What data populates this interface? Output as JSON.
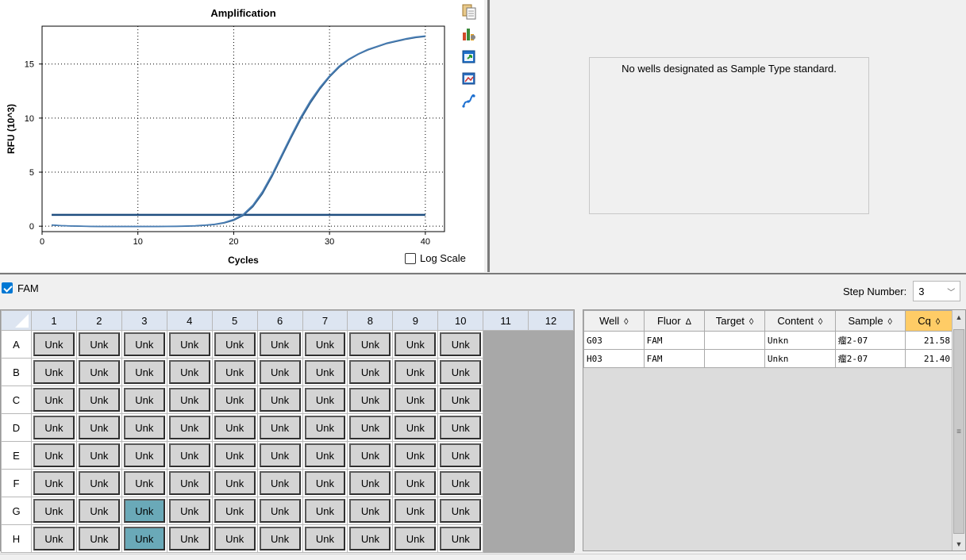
{
  "chart_data": {
    "type": "line",
    "title": "Amplification",
    "xlabel": "Cycles",
    "ylabel": "RFU (10^3)",
    "xlim": [
      0,
      42
    ],
    "ylim": [
      -0.5,
      18.5
    ],
    "xticks": [
      0,
      10,
      20,
      30,
      40
    ],
    "yticks": [
      0,
      5,
      10,
      15
    ],
    "grid": true,
    "threshold": 1.05,
    "series": [
      {
        "well": "G03",
        "color": "#2f5f8f",
        "x": [
          1,
          2,
          3,
          4,
          5,
          6,
          7,
          8,
          9,
          10,
          11,
          12,
          13,
          14,
          15,
          16,
          17,
          18,
          19,
          20,
          21,
          22,
          23,
          24,
          25,
          26,
          27,
          28,
          29,
          30,
          31,
          32,
          33,
          34,
          35,
          36,
          37,
          38,
          39,
          40
        ],
        "y": [
          0.1,
          0.05,
          0.02,
          0,
          -0.02,
          -0.03,
          -0.03,
          -0.03,
          -0.03,
          -0.03,
          -0.03,
          -0.03,
          -0.02,
          -0.02,
          0,
          0.03,
          0.08,
          0.15,
          0.3,
          0.55,
          1.0,
          1.8,
          3.0,
          4.6,
          6.4,
          8.2,
          9.9,
          11.4,
          12.7,
          13.8,
          14.7,
          15.4,
          15.9,
          16.3,
          16.6,
          16.9,
          17.1,
          17.3,
          17.45,
          17.55
        ]
      },
      {
        "well": "H03",
        "color": "#4a7fb5",
        "x": [
          1,
          2,
          3,
          4,
          5,
          6,
          7,
          8,
          9,
          10,
          11,
          12,
          13,
          14,
          15,
          16,
          17,
          18,
          19,
          20,
          21,
          22,
          23,
          24,
          25,
          26,
          27,
          28,
          29,
          30,
          31,
          32,
          33,
          34,
          35,
          36,
          37,
          38,
          39,
          40
        ],
        "y": [
          0.12,
          0.06,
          0.03,
          0.01,
          -0.01,
          -0.02,
          -0.02,
          -0.02,
          -0.02,
          -0.02,
          -0.02,
          -0.02,
          -0.01,
          0,
          0.02,
          0.05,
          0.1,
          0.18,
          0.34,
          0.62,
          1.1,
          1.95,
          3.2,
          4.8,
          6.6,
          8.4,
          10.1,
          11.6,
          12.85,
          13.9,
          14.8,
          15.45,
          15.95,
          16.35,
          16.65,
          16.95,
          17.15,
          17.35,
          17.5,
          17.6
        ]
      }
    ]
  },
  "chart": {
    "log_scale_label": "Log Scale",
    "tools": [
      "copy-icon",
      "chart-settings-icon",
      "export-icon",
      "zoom-icon",
      "trace-icon"
    ]
  },
  "standard_panel": {
    "message": "No wells designated as Sample Type standard."
  },
  "fluor": {
    "label": "FAM",
    "checked": true
  },
  "step": {
    "label": "Step Number:",
    "value": "3"
  },
  "plate": {
    "columns": [
      "1",
      "2",
      "3",
      "4",
      "5",
      "6",
      "7",
      "8",
      "9",
      "10",
      "11",
      "12"
    ],
    "rows": [
      "A",
      "B",
      "C",
      "D",
      "E",
      "F",
      "G",
      "H"
    ],
    "well_label": "Unk",
    "filled_columns": 10,
    "selected": [
      "G3",
      "H3"
    ]
  },
  "results": {
    "columns": [
      "Well",
      "Fluor",
      "Target",
      "Content",
      "Sample",
      "Cq"
    ],
    "sort_icons": [
      "◊",
      "Δ",
      "◊",
      "◊",
      "◊",
      "◊"
    ],
    "rows": [
      {
        "well": "G03",
        "fluor": "FAM",
        "target": "",
        "content": "Unkn",
        "sample": "瘤2-07",
        "cq": "21.58"
      },
      {
        "well": "H03",
        "fluor": "FAM",
        "target": "",
        "content": "Unkn",
        "sample": "瘤2-07",
        "cq": "21.40"
      }
    ]
  }
}
